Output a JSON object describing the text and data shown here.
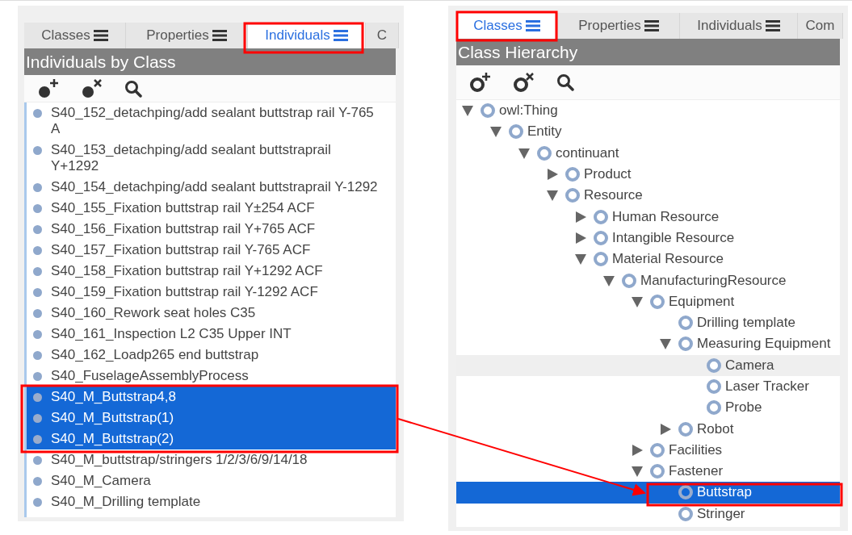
{
  "left_panel": {
    "tabs": [
      {
        "label": "Classes",
        "selected": false
      },
      {
        "label": "Properties",
        "selected": false
      },
      {
        "label": "Individuals",
        "selected": true
      },
      {
        "label": "C",
        "selected": false
      }
    ],
    "title": "Individuals by Class",
    "individuals": [
      {
        "label": "S40_152_detachping/add sealant buttstrap rail Y-765 A",
        "selected": false
      },
      {
        "label": "S40_153_detachping/add sealant buttstraprail Y+1292",
        "selected": false
      },
      {
        "label": "S40_154_detachping/add sealant buttstraprail Y-1292",
        "selected": false
      },
      {
        "label": "S40_155_Fixation buttstrap rail Y±254 ACF",
        "selected": false
      },
      {
        "label": "S40_156_Fixation buttstrap rail Y+765 ACF",
        "selected": false
      },
      {
        "label": "S40_157_Fixation buttstrap rail Y-765 ACF",
        "selected": false
      },
      {
        "label": "S40_158_Fixation buttstrap rail Y+1292 ACF",
        "selected": false
      },
      {
        "label": "S40_159_Fixation buttstrap rail Y-1292 ACF",
        "selected": false
      },
      {
        "label": "S40_160_Rework seat holes C35",
        "selected": false
      },
      {
        "label": "S40_161_Inspection L2 C35 Upper INT",
        "selected": false
      },
      {
        "label": "S40_162_Loadp265 end buttstrap",
        "selected": false
      },
      {
        "label": "S40_FuselageAssemblyProcess",
        "selected": false
      },
      {
        "label": "S40_M_Buttstrap4,8",
        "selected": true
      },
      {
        "label": "S40_M_Buttstrap(1)",
        "selected": true
      },
      {
        "label": "S40_M_Buttstrap(2)",
        "selected": true
      },
      {
        "label": "S40_M_buttstrap/stringers 1/2/3/6/9/14/18",
        "selected": false
      },
      {
        "label": "S40_M_Camera",
        "selected": false
      },
      {
        "label": "S40_M_Drilling template",
        "selected": false
      }
    ]
  },
  "right_panel": {
    "tabs": [
      {
        "label": "Classes",
        "selected": true
      },
      {
        "label": "Properties",
        "selected": false
      },
      {
        "label": "Individuals",
        "selected": false
      },
      {
        "label": "Com",
        "selected": false
      }
    ],
    "title": "Class Hierarchy",
    "tree": [
      {
        "label": "owl:Thing",
        "expanded": true,
        "selected": false,
        "hovered": false,
        "children": [
          {
            "label": "Entity",
            "expanded": true,
            "selected": false,
            "hovered": false,
            "children": [
              {
                "label": "continuant",
                "expanded": true,
                "selected": false,
                "hovered": false,
                "children": [
                  {
                    "label": "Product",
                    "expanded": false,
                    "selected": false,
                    "hovered": false
                  },
                  {
                    "label": "Resource",
                    "expanded": true,
                    "selected": false,
                    "hovered": false,
                    "children": [
                      {
                        "label": "Human Resource",
                        "expanded": false,
                        "selected": false,
                        "hovered": false
                      },
                      {
                        "label": "Intangible Resource",
                        "expanded": false,
                        "selected": false,
                        "hovered": false
                      },
                      {
                        "label": "Material Resource",
                        "expanded": true,
                        "selected": false,
                        "hovered": false,
                        "children": [
                          {
                            "label": "ManufacturingResource",
                            "expanded": true,
                            "selected": false,
                            "hovered": false,
                            "children": [
                              {
                                "label": "Equipment",
                                "expanded": true,
                                "selected": false,
                                "hovered": false,
                                "children": [
                                  {
                                    "label": "Drilling template",
                                    "selected": false,
                                    "hovered": false
                                  },
                                  {
                                    "label": "Measuring Equipment",
                                    "expanded": true,
                                    "selected": false,
                                    "hovered": false,
                                    "children": [
                                      {
                                        "label": "Camera",
                                        "selected": false,
                                        "hovered": true
                                      },
                                      {
                                        "label": "Laser Tracker",
                                        "selected": false,
                                        "hovered": false
                                      },
                                      {
                                        "label": "Probe",
                                        "selected": false,
                                        "hovered": false
                                      }
                                    ]
                                  },
                                  {
                                    "label": "Robot",
                                    "expanded": false,
                                    "selected": false,
                                    "hovered": false
                                  }
                                ]
                              },
                              {
                                "label": "Facilities",
                                "expanded": false,
                                "selected": false,
                                "hovered": false
                              },
                              {
                                "label": "Fastener",
                                "expanded": true,
                                "selected": false,
                                "hovered": false,
                                "children": [
                                  {
                                    "label": "Buttstrap",
                                    "selected": true,
                                    "hovered": false
                                  },
                                  {
                                    "label": "Stringer",
                                    "selected": false,
                                    "hovered": false
                                  }
                                ]
                              }
                            ]
                          }
                        ]
                      }
                    ]
                  }
                ]
              }
            ]
          }
        ]
      }
    ]
  }
}
